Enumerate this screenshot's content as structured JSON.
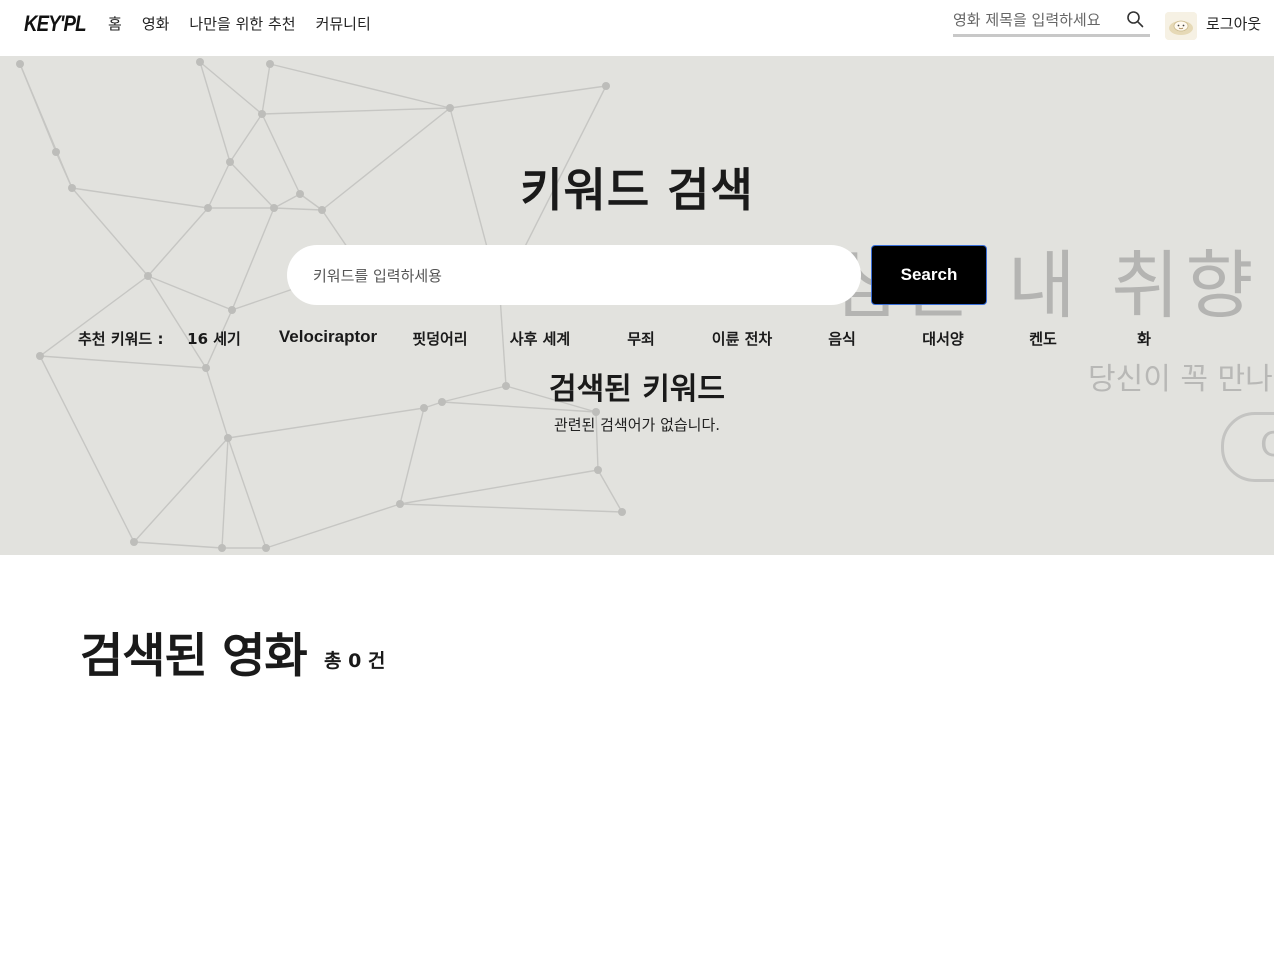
{
  "header": {
    "logo": "KEY'PL",
    "nav": [
      "홈",
      "영화",
      "나만을 위한 추천",
      "커뮤니티"
    ],
    "search_placeholder": "영화 제목을 입력하세요",
    "logout_label": "로그아웃"
  },
  "hero": {
    "title": "키워드 검색",
    "search_placeholder": "키워드를 입력하세용",
    "search_button": "Search",
    "recommend_label": "추천 키워드 :",
    "keywords": [
      "16 세기",
      "Velociraptor",
      "핏덩어리",
      "사후 세계",
      "무죄",
      "이륜 전차",
      "음식",
      "대서양",
      "켄도",
      "화"
    ],
    "found_title": "검색된 키워드",
    "found_empty": "관련된 검색어가 없습니다.",
    "bg_text_big": "심은 내 취향",
    "bg_text_sub": "당신이 꼭 만나야",
    "bg_pill": "C"
  },
  "results": {
    "title": "검색된 영화",
    "count": "총 0 건"
  },
  "colors": {
    "hero_bg": "#e2e2de",
    "button_bg": "#000000",
    "button_text": "#ffffff",
    "text": "#1a1a1a"
  },
  "icons": {
    "search": "search-icon",
    "avatar": "avatar-image"
  }
}
